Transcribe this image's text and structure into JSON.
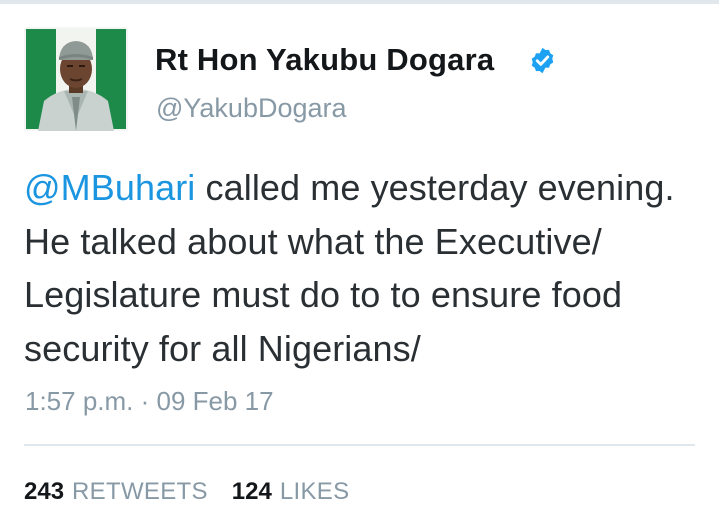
{
  "tweet": {
    "author": {
      "display_name": "Rt Hon Yakubu Dogara",
      "handle": "@YakubDogara",
      "verified_icon": "verified-badge-icon"
    },
    "text": {
      "mention": "@MBuhari",
      "body": " called me yesterday evening. He talked about what the Executive/ Legislature must do to to ensure food security for all Nigerians/"
    },
    "timestamp": "1:57 p.m. · 09 Feb 17",
    "stats": {
      "retweets_count": "243",
      "retweets_label": "RETWEETS",
      "likes_count": "124",
      "likes_label": "LIKES"
    }
  },
  "colors": {
    "link": "#1b95e0",
    "verified": "#1da1f2",
    "muted": "#8899a6",
    "text": "#292f33"
  }
}
